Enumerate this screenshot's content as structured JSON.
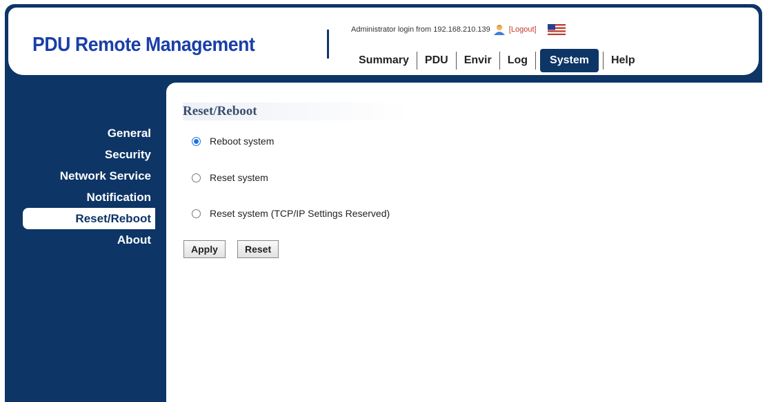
{
  "header": {
    "brand": "PDU Remote Management",
    "login_text": "Administrator login from 192.168.210.139",
    "logout_label": "[Logout]",
    "user_icon": "user-icon",
    "flag_icon": "us-flag-icon"
  },
  "nav": {
    "tabs": [
      {
        "label": "Summary"
      },
      {
        "label": "PDU"
      },
      {
        "label": "Envir"
      },
      {
        "label": "Log"
      },
      {
        "label": "System",
        "active": true
      },
      {
        "label": "Help"
      }
    ]
  },
  "sidebar": {
    "items": [
      {
        "label": "General"
      },
      {
        "label": "Security"
      },
      {
        "label": "Network Service"
      },
      {
        "label": "Notification"
      },
      {
        "label": "Reset/Reboot",
        "active": true
      },
      {
        "label": "About"
      }
    ]
  },
  "main": {
    "title": "Reset/Reboot",
    "options": [
      {
        "label": "Reboot system",
        "checked": true
      },
      {
        "label": "Reset system",
        "checked": false
      },
      {
        "label": "Reset system (TCP/IP Settings Reserved)",
        "checked": false
      }
    ],
    "apply_label": "Apply",
    "reset_label": "Reset"
  },
  "colors": {
    "brand": "#1a3fa8",
    "frame": "#0d3566",
    "radio_selected": "#1a73e8",
    "logout": "#c0392b"
  }
}
